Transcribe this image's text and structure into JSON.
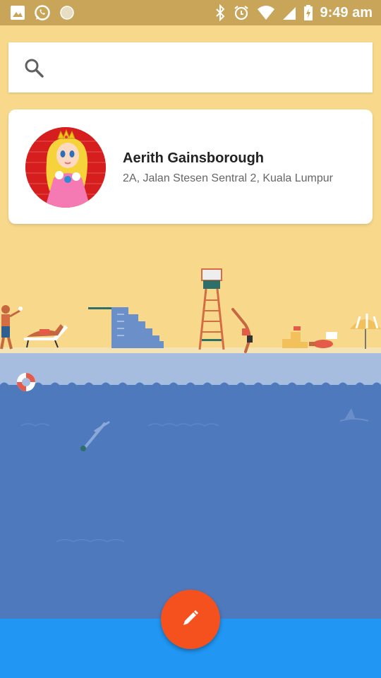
{
  "status_bar": {
    "time": "9:49 am",
    "left_icons": [
      "image-icon",
      "whatsapp-icon",
      "circle-icon"
    ],
    "right_icons": [
      "bluetooth-icon",
      "alarm-icon",
      "wifi-icon",
      "signal-icon",
      "battery-charging-icon"
    ]
  },
  "search": {
    "placeholder": "",
    "value": ""
  },
  "contact": {
    "name": "Aerith Gainsborough",
    "address": "2A, Jalan Stesen Sentral 2, Kuala Lumpur",
    "avatar": "princess-avatar"
  },
  "fab": {
    "icon": "pencil-icon"
  },
  "colors": {
    "sand": "#f8d98b",
    "status_bar": "#c9a55a",
    "water": "#4f79bd",
    "shallow_water": "#9fb7de",
    "bottom_bar": "#2196f3",
    "fab": "#f4511e"
  }
}
